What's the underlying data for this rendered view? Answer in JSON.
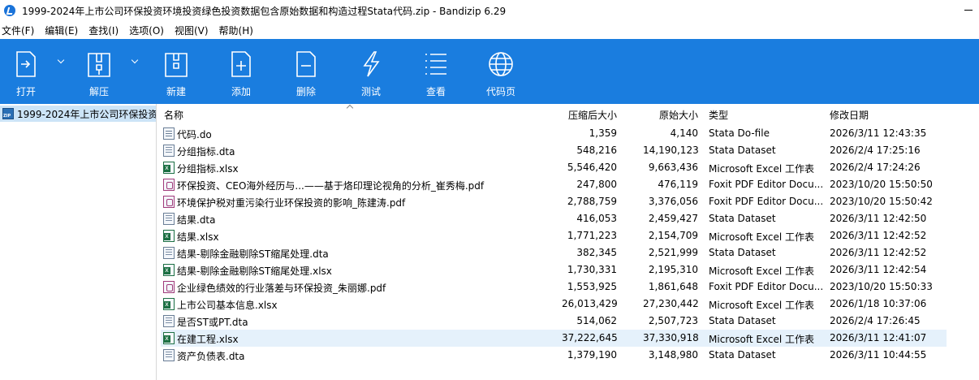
{
  "window": {
    "title": "1999-2024年上市公司环保投资环境投资绿色投资数据包含原始数据和构造过程Stata代码.zip - Bandizip 6.29"
  },
  "menu": [
    {
      "label": "文件(F)"
    },
    {
      "label": "编辑(E)"
    },
    {
      "label": "查找(I)"
    },
    {
      "label": "选项(O)"
    },
    {
      "label": "视图(V)"
    },
    {
      "label": "帮助(H)"
    }
  ],
  "toolbar": {
    "open": "打开",
    "extract": "解压",
    "new": "新建",
    "add": "添加",
    "delete": "删除",
    "test": "测试",
    "view": "查看",
    "codepage": "代码页"
  },
  "tree": {
    "root_label": "1999-2024年上市公司环保投资"
  },
  "columns": {
    "name": "名称",
    "compressed": "压缩后大小",
    "original": "原始大小",
    "type": "类型",
    "modified": "修改日期"
  },
  "files": [
    {
      "name": "代码.do",
      "compressed": "1,359",
      "original": "4,140",
      "type": "Stata Do-file",
      "modified": "2026/3/11 12:43:35",
      "icon": "do-file-icon"
    },
    {
      "name": "分组指标.dta",
      "compressed": "548,216",
      "original": "14,190,123",
      "type": "Stata Dataset",
      "modified": "2026/2/4 17:25:16",
      "icon": "dta-file-icon"
    },
    {
      "name": "分组指标.xlsx",
      "compressed": "5,546,420",
      "original": "9,663,436",
      "type": "Microsoft Excel 工作表",
      "modified": "2026/2/4 17:24:26",
      "icon": "excel-file-icon"
    },
    {
      "name": "环保投资、CEO海外经历与...——基于烙印理论视角的分析_崔秀梅.pdf",
      "compressed": "247,800",
      "original": "476,119",
      "type": "Foxit PDF Editor Docu...",
      "modified": "2023/10/20 15:50:50",
      "icon": "pdf-file-icon"
    },
    {
      "name": "环境保护税对重污染行业环保投资的影响_陈建涛.pdf",
      "compressed": "2,788,759",
      "original": "3,376,056",
      "type": "Foxit PDF Editor Docu...",
      "modified": "2023/10/20 15:50:42",
      "icon": "pdf-file-icon"
    },
    {
      "name": "结果.dta",
      "compressed": "416,053",
      "original": "2,459,427",
      "type": "Stata Dataset",
      "modified": "2026/3/11 12:42:50",
      "icon": "dta-file-icon"
    },
    {
      "name": "结果.xlsx",
      "compressed": "1,771,223",
      "original": "2,154,709",
      "type": "Microsoft Excel 工作表",
      "modified": "2026/3/11 12:42:52",
      "icon": "excel-file-icon"
    },
    {
      "name": "结果-剔除金融剔除ST缩尾处理.dta",
      "compressed": "382,345",
      "original": "2,521,999",
      "type": "Stata Dataset",
      "modified": "2026/3/11 12:42:52",
      "icon": "dta-file-icon"
    },
    {
      "name": "结果-剔除金融剔除ST缩尾处理.xlsx",
      "compressed": "1,730,331",
      "original": "2,195,310",
      "type": "Microsoft Excel 工作表",
      "modified": "2026/3/11 12:42:54",
      "icon": "excel-file-icon"
    },
    {
      "name": "企业绿色绩效的行业落差与环保投资_朱丽娜.pdf",
      "compressed": "1,553,925",
      "original": "1,861,648",
      "type": "Foxit PDF Editor Docu...",
      "modified": "2023/10/20 15:50:33",
      "icon": "pdf-file-icon"
    },
    {
      "name": "上市公司基本信息.xlsx",
      "compressed": "26,013,429",
      "original": "27,230,442",
      "type": "Microsoft Excel 工作表",
      "modified": "2026/1/18 10:37:06",
      "icon": "excel-file-icon"
    },
    {
      "name": "是否ST或PT.dta",
      "compressed": "514,062",
      "original": "2,507,723",
      "type": "Stata Dataset",
      "modified": "2026/2/4 17:26:45",
      "icon": "dta-file-icon"
    },
    {
      "name": "在建工程.xlsx",
      "compressed": "37,222,645",
      "original": "37,330,918",
      "type": "Microsoft Excel 工作表",
      "modified": "2026/3/11 12:41:07",
      "icon": "excel-file-icon",
      "selected": true
    },
    {
      "name": "资产负债表.dta",
      "compressed": "1,379,190",
      "original": "3,148,980",
      "type": "Stata Dataset",
      "modified": "2026/3/11 10:44:55",
      "icon": "dta-file-icon"
    }
  ]
}
